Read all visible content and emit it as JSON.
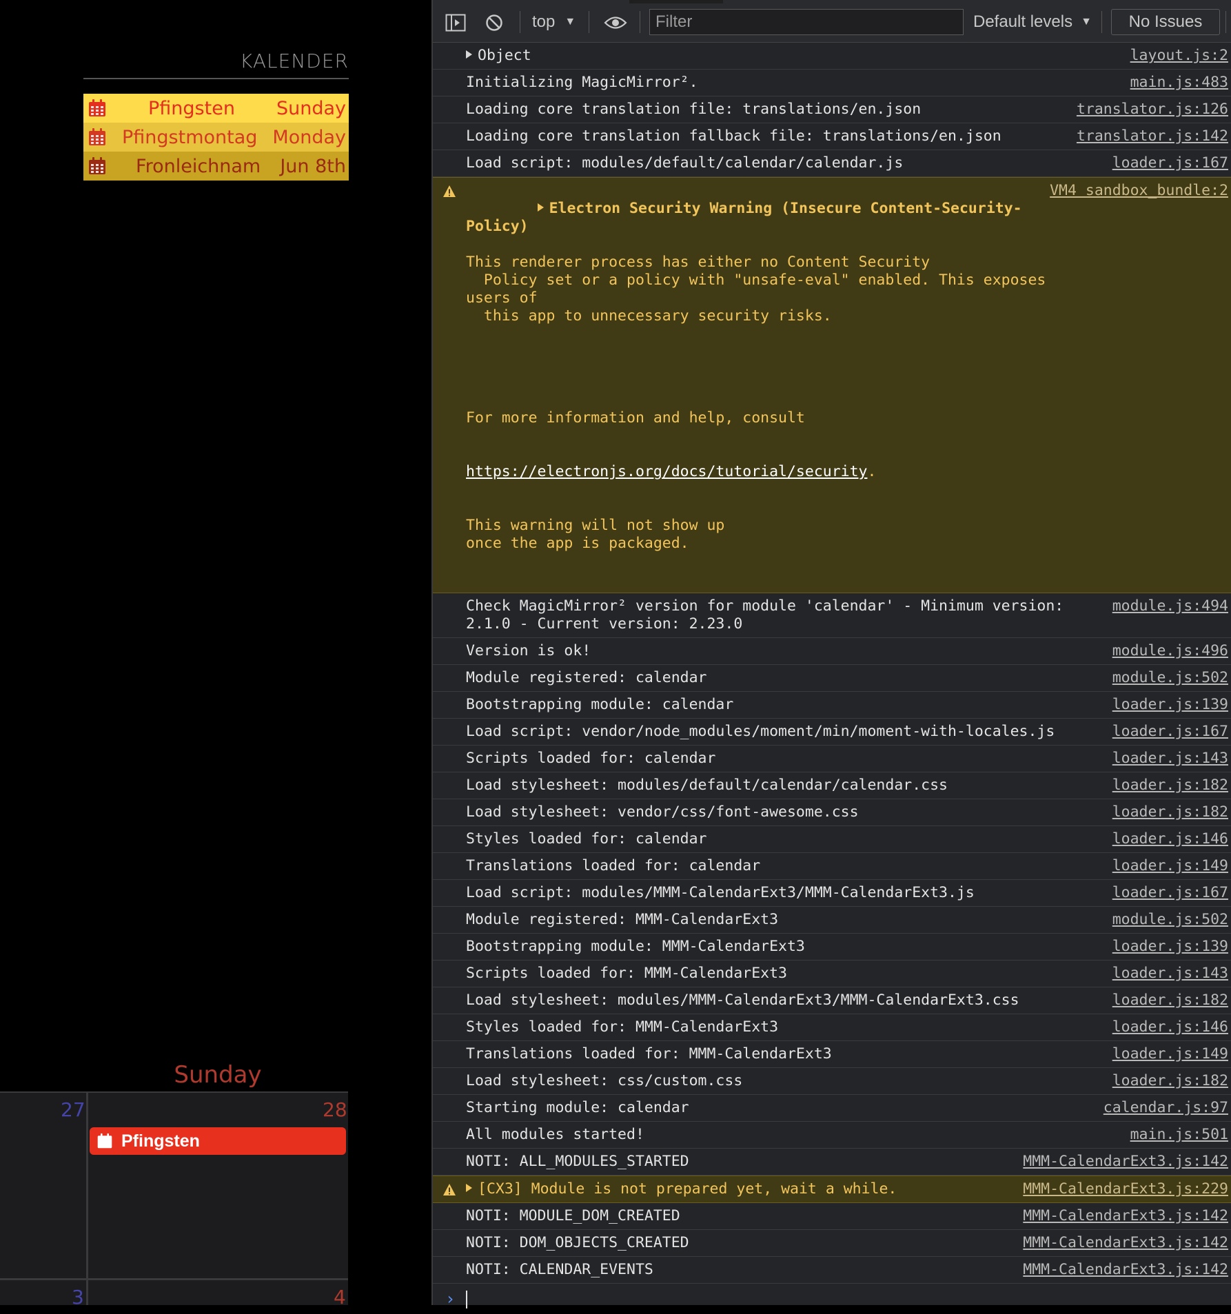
{
  "mirror": {
    "calendar_title": "KALENDER",
    "events": [
      {
        "name": "Pfingsten",
        "when": "Sunday"
      },
      {
        "name": "Pfingstmontag",
        "when": "Monday"
      },
      {
        "name": "Fronleichnam",
        "when": "Jun 8th"
      }
    ],
    "week_view": {
      "day_header": "Sunday",
      "day_numbers": [
        "27",
        "28",
        "3",
        "4"
      ],
      "event": "Pfingsten"
    }
  },
  "devtools": {
    "toolbar": {
      "context": "top",
      "filter_placeholder": "Filter",
      "levels": "Default levels",
      "issues": "No Issues"
    },
    "messages": [
      {
        "text": "Object",
        "source": "layout.js:2",
        "expandable": true
      },
      {
        "text": "Initializing MagicMirror².",
        "source": "main.js:483"
      },
      {
        "text": "Loading core translation file: translations/en.json",
        "source": "translator.js:126"
      },
      {
        "text": "Loading core translation fallback file: translations/en.json",
        "source": "translator.js:142"
      },
      {
        "text": "Load script: modules/default/calendar/calendar.js",
        "source": "loader.js:167"
      },
      {
        "type": "warning",
        "title": "Electron Security Warning (Insecure Content-Security-Policy)",
        "body_1": "This renderer process has either no Content Security\n  Policy set or a policy with \"unsafe-eval\" enabled. This exposes users of\n  this app to unnecessary security risks.",
        "body_2": "For more information and help, consult",
        "link": "https://electronjs.org/docs/tutorial/security",
        "body_3": "This warning will not show up\nonce the app is packaged.",
        "source": "VM4 sandbox_bundle:2"
      },
      {
        "text": "Check MagicMirror² version for module 'calendar' - Minimum version:\n2.1.0 - Current version: 2.23.0",
        "source": "module.js:494"
      },
      {
        "text": "Version is ok!",
        "source": "module.js:496"
      },
      {
        "text": "Module registered: calendar",
        "source": "module.js:502"
      },
      {
        "text": "Bootstrapping module: calendar",
        "source": "loader.js:139"
      },
      {
        "text": "Load script: vendor/node_modules/moment/min/moment-with-locales.js",
        "source": "loader.js:167"
      },
      {
        "text": "Scripts loaded for: calendar",
        "source": "loader.js:143"
      },
      {
        "text": "Load stylesheet: modules/default/calendar/calendar.css",
        "source": "loader.js:182"
      },
      {
        "text": "Load stylesheet: vendor/css/font-awesome.css",
        "source": "loader.js:182"
      },
      {
        "text": "Styles loaded for: calendar",
        "source": "loader.js:146"
      },
      {
        "text": "Translations loaded for: calendar",
        "source": "loader.js:149"
      },
      {
        "text": "Load script: modules/MMM-CalendarExt3/MMM-CalendarExt3.js",
        "source": "loader.js:167"
      },
      {
        "text": "Module registered: MMM-CalendarExt3",
        "source": "module.js:502"
      },
      {
        "text": "Bootstrapping module: MMM-CalendarExt3",
        "source": "loader.js:139"
      },
      {
        "text": "Scripts loaded for: MMM-CalendarExt3",
        "source": "loader.js:143"
      },
      {
        "text": "Load stylesheet: modules/MMM-CalendarExt3/MMM-CalendarExt3.css",
        "source": "loader.js:182"
      },
      {
        "text": "Styles loaded for: MMM-CalendarExt3",
        "source": "loader.js:146"
      },
      {
        "text": "Translations loaded for: MMM-CalendarExt3",
        "source": "loader.js:149"
      },
      {
        "text": "Load stylesheet: css/custom.css",
        "source": "loader.js:182"
      },
      {
        "text": "Starting module: calendar",
        "source": "calendar.js:97"
      },
      {
        "text": "All modules started!",
        "source": "main.js:501"
      },
      {
        "text": "NOTI: ALL_MODULES_STARTED",
        "source": "MMM-CalendarExt3.js:142"
      },
      {
        "type": "warning",
        "text": "[CX3] Module is not prepared yet, wait a while.",
        "source": "MMM-CalendarExt3.js:229",
        "expandable": true
      },
      {
        "text": "NOTI: MODULE_DOM_CREATED",
        "source": "MMM-CalendarExt3.js:142"
      },
      {
        "text": "NOTI: DOM_OBJECTS_CREATED",
        "source": "MMM-CalendarExt3.js:142"
      },
      {
        "text": "NOTI: CALENDAR_EVENTS",
        "source": "MMM-CalendarExt3.js:142"
      }
    ]
  }
}
